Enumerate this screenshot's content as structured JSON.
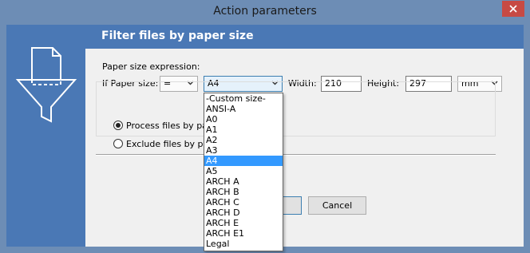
{
  "window": {
    "title": "Action parameters"
  },
  "header": {
    "title": "Filter files by paper size"
  },
  "form": {
    "expression_label": "Paper size expression:",
    "if_label": "If Paper size:",
    "operator_value": "=",
    "size_value": "A4",
    "width_label": "Width:",
    "width_value": "210",
    "height_label": "Height:",
    "height_value": "297",
    "unit_value": "mm"
  },
  "options": {
    "process_label": "Process files by pap",
    "exclude_label": "Exclude files by pap",
    "selected": "process"
  },
  "buttons": {
    "cancel_label": "Cancel"
  },
  "dropdown": {
    "items": [
      "-Custom size-",
      "ANSI-A",
      "A0",
      "A1",
      "A2",
      "A3",
      "A4",
      "A5",
      "ARCH A",
      "ARCH B",
      "ARCH C",
      "ARCH D",
      "ARCH E",
      "ARCH E1",
      "Legal"
    ],
    "selected_index": 6
  },
  "colors": {
    "frame": "#6d8db5",
    "header": "#4a78b5",
    "highlight": "#3399ff",
    "close": "#c74a44"
  }
}
